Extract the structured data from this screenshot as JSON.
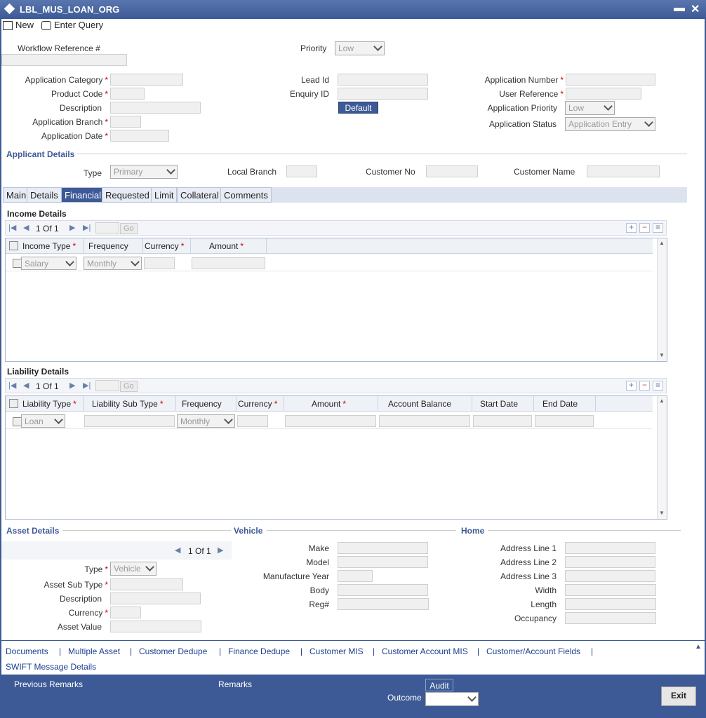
{
  "window": {
    "title": "LBL_MUS_LOAN_ORG",
    "minimize": "▬",
    "close": "✕"
  },
  "toolbar": {
    "new": "New",
    "enter_query": "Enter Query"
  },
  "header": {
    "workflow_ref": "Workflow Reference #",
    "priority": "Priority",
    "priority_value": "Low",
    "app_category": "Application Category",
    "product_code": "Product Code",
    "description": "Description",
    "app_branch": "Application Branch",
    "app_date": "Application Date",
    "lead_id": "Lead Id",
    "enquiry_id": "Enquiry ID",
    "default_btn": "Default",
    "app_number": "Application Number",
    "user_ref": "User Reference",
    "app_priority": "Application Priority",
    "app_priority_value": "Low",
    "app_status": "Application Status",
    "app_status_value": "Application Entry",
    "req": "*"
  },
  "applicant": {
    "title": "Applicant Details",
    "type": "Type",
    "type_value": "Primary",
    "local_branch": "Local Branch",
    "customer_no": "Customer No",
    "customer_name": "Customer Name"
  },
  "tabs": [
    "Main",
    "Details",
    "Financial",
    "Requested",
    "Limit",
    "Collateral",
    "Comments"
  ],
  "income": {
    "title": "Income Details",
    "page": "1 Of 1",
    "go": "Go",
    "columns": [
      "Income Type",
      "Frequency",
      "Currency",
      "Amount"
    ],
    "row": {
      "income_type": "Salary",
      "frequency": "Monthly"
    }
  },
  "liability": {
    "title": "Liability Details",
    "page": "1 Of 1",
    "go": "Go",
    "columns": [
      "Liability Type",
      "Liability Sub Type",
      "Frequency",
      "Currency",
      "Amount",
      "Account Balance",
      "Start Date",
      "End Date"
    ],
    "row": {
      "liability_type": "Loan",
      "frequency": "Monthly"
    }
  },
  "asset": {
    "title": "Asset Details",
    "page": "1 Of 1",
    "type": "Type",
    "type_value": "Vehicle",
    "sub_type": "Asset Sub Type",
    "description": "Description",
    "currency": "Currency",
    "value": "Asset Value"
  },
  "vehicle": {
    "title": "Vehicle",
    "make": "Make",
    "model": "Model",
    "manufacture_year": "Manufacture Year",
    "body": "Body",
    "reg": "Reg#"
  },
  "home": {
    "title": "Home",
    "addr1": "Address Line 1",
    "addr2": "Address Line 2",
    "addr3": "Address Line 3",
    "width": "Width",
    "length": "Length",
    "occupancy": "Occupancy"
  },
  "links": [
    "Documents",
    "Multiple Asset",
    "Customer Dedupe",
    "Finance Dedupe",
    "Customer MIS",
    "Customer Account MIS",
    "Customer/Account Fields",
    "SWIFT Message Details"
  ],
  "link_sep": "|",
  "footer": {
    "prev_remarks": "Previous Remarks",
    "remarks": "Remarks",
    "audit": "Audit",
    "outcome": "Outcome",
    "exit": "Exit"
  }
}
